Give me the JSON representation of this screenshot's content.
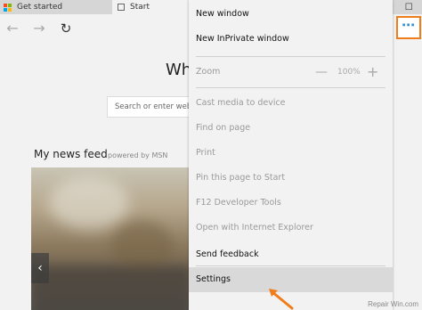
{
  "tabs": [
    {
      "label": "Get started",
      "active": false
    },
    {
      "label": "Start",
      "active": true
    }
  ],
  "window_controls": {
    "minimize": "—",
    "maximize": "☐"
  },
  "nav": {
    "back": "←",
    "forward": "→",
    "refresh": "↻",
    "more": "⋯"
  },
  "accent_color": "#f07d1b",
  "more_color": "#2e8fd6",
  "page": {
    "heading": "Whe",
    "search_placeholder": "Search or enter web ad",
    "news_title": "My news feed",
    "powered_by": "powered by MSN",
    "prev_icon": "‹"
  },
  "menu": {
    "new_window": "New window",
    "new_inprivate": "New InPrivate window",
    "zoom": "Zoom",
    "zoom_minus": "—",
    "zoom_value": "100%",
    "zoom_plus": "+",
    "cast": "Cast media to device",
    "find": "Find on page",
    "print": "Print",
    "pin": "Pin this page to Start",
    "f12": "F12 Developer Tools",
    "open_ie": "Open with Internet Explorer",
    "feedback": "Send feedback",
    "settings": "Settings"
  },
  "watermark": "Repair Win.com"
}
